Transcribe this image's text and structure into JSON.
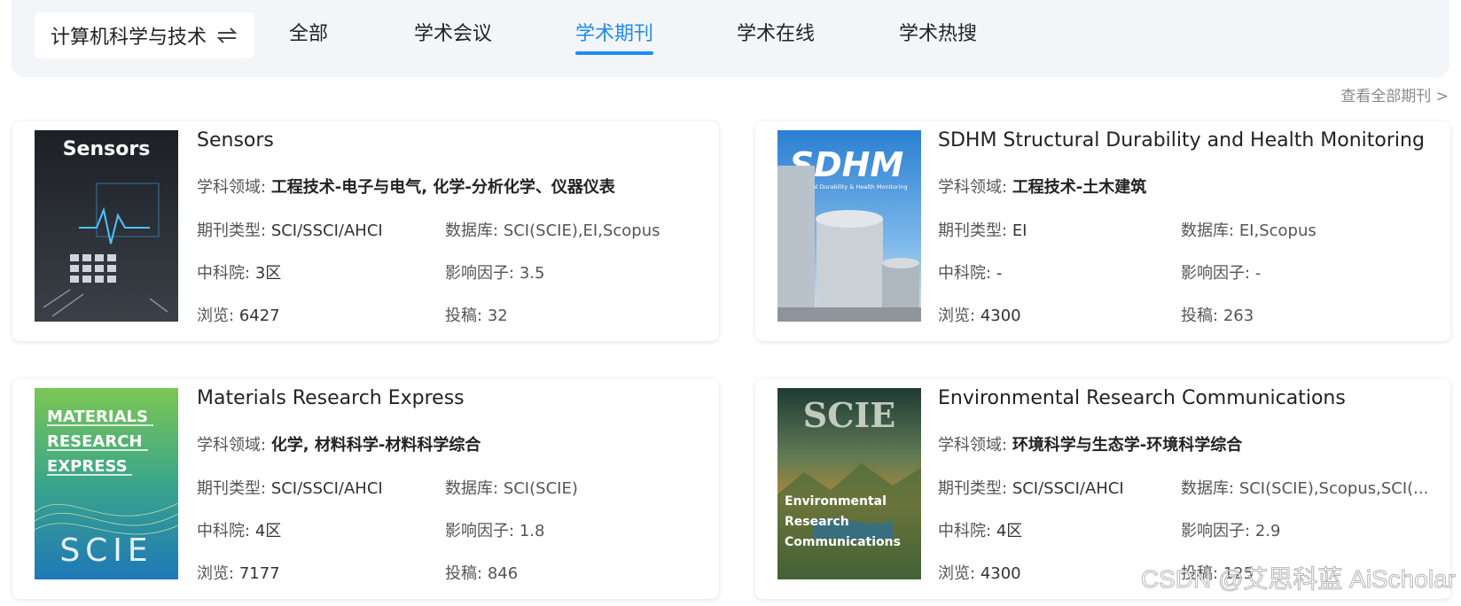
{
  "nav": {
    "field_label": "计算机科学与技术",
    "tabs": [
      {
        "label": "全部"
      },
      {
        "label": "学术会议"
      },
      {
        "label": "学术期刊"
      },
      {
        "label": "学术在线"
      },
      {
        "label": "学术热搜"
      }
    ],
    "active_tab": "学术期刊",
    "accent_color": "#1e8cf0"
  },
  "view_all": "查看全部期刊 >",
  "labels": {
    "subject": "学科领域:",
    "type": "期刊类型:",
    "database": "数据库:",
    "cas": "中科院:",
    "impact": "影响因子:",
    "views": "浏览:",
    "submissions": "投稿:"
  },
  "journals": [
    {
      "title": "Sensors",
      "cover_text": "Sensors",
      "subject": "工程技术-电子与电气, 化学-分析化学、仪器仪表",
      "type": "SCI/SSCI/AHCI",
      "database": "SCI(SCIE),EI,Scopus",
      "cas": "3区",
      "impact": "3.5",
      "views": "6427",
      "submissions": "32"
    },
    {
      "title": "SDHM Structural Durability and Health Monitoring",
      "cover_text": "SDHM",
      "cover_subtext": "Structural Durability & Health Monitoring",
      "subject": "工程技术-土木建筑",
      "type": "EI",
      "database": "EI,Scopus",
      "cas": "-",
      "impact": "-",
      "views": "4300",
      "submissions": "263"
    },
    {
      "title": "Materials Research Express",
      "cover_lines": [
        "MATERIALS",
        "RESEARCH",
        "EXPRESS"
      ],
      "cover_badge": "SCIE",
      "subject": "化学, 材料科学-材料科学综合",
      "type": "SCI/SSCI/AHCI",
      "database": "SCI(SCIE)",
      "cas": "4区",
      "impact": "1.8",
      "views": "7177",
      "submissions": "846"
    },
    {
      "title": "Environmental Research Communications",
      "cover_badge": "SCIE",
      "cover_lines": [
        "Environmental",
        "Research",
        "Communications"
      ],
      "subject": "环境科学与生态学-环境科学综合",
      "type": "SCI/SSCI/AHCI",
      "database": "SCI(SCIE),Scopus,SCI(...",
      "cas": "4区",
      "impact": "2.9",
      "views": "4300",
      "submissions": "125"
    }
  ],
  "watermark": "CSDN @艾思科蓝 AiScholar"
}
